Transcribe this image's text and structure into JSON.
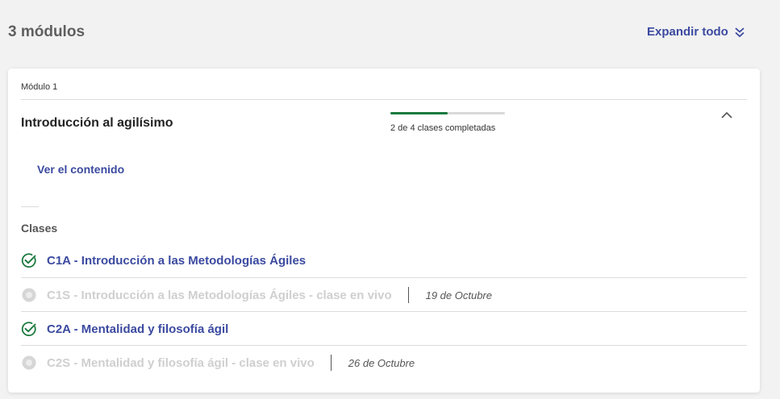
{
  "header": {
    "module_count": "3 módulos",
    "expand_all": "Expandir todo"
  },
  "module": {
    "label": "Módulo 1",
    "title": "Introducción al agilísimo",
    "progress_text": "2 de 4 clases completadas",
    "progress_fraction": 0.5,
    "view_content": "Ver el contenido",
    "classes_label": "Clases",
    "classes": [
      {
        "title": "C1A - Introducción a las Metodologías Ágiles",
        "status": "completed",
        "date": ""
      },
      {
        "title": "C1S - Introducción a las Metodologías Ágiles - clase en vivo",
        "status": "disabled",
        "date": "19 de Octubre"
      },
      {
        "title": "C2A - Mentalidad y filosofía ágil",
        "status": "completed",
        "date": ""
      },
      {
        "title": "C2S - Mentalidad y filosofía ágil - clase en vivo",
        "status": "disabled",
        "date": "26 de Octubre"
      }
    ]
  },
  "colors": {
    "accent": "#3b4aa0",
    "success": "#1a7a3e",
    "disabled": "#cfcfcf"
  },
  "icons": {
    "expand": "chevrons-down-icon",
    "collapse": "chevron-up-icon",
    "completed": "check-circle-icon",
    "pending": "circle-icon"
  }
}
